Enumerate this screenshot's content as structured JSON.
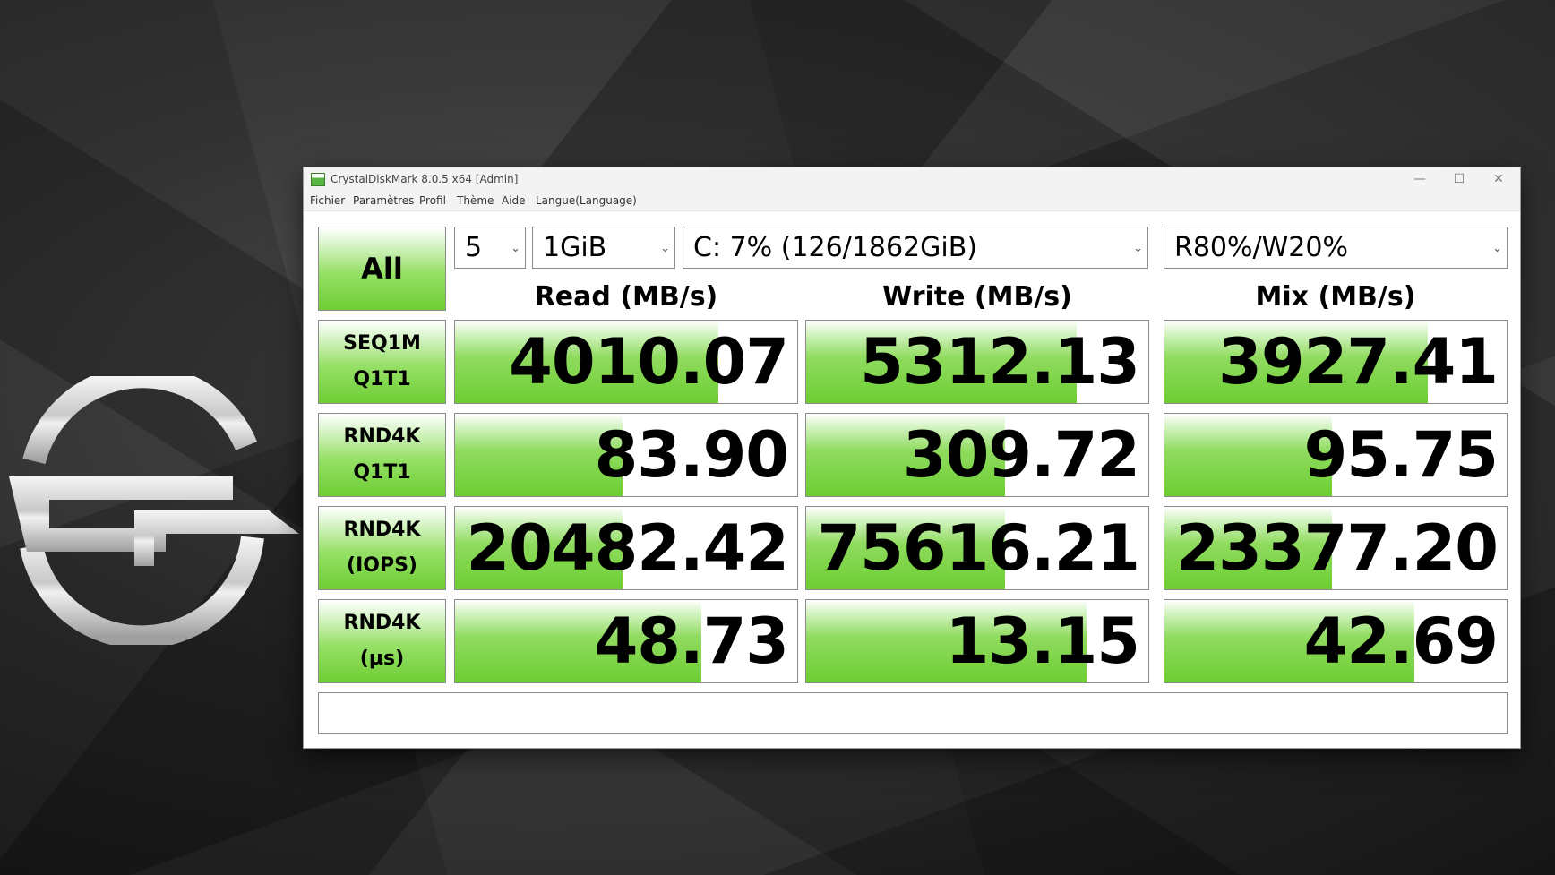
{
  "window": {
    "title": "CrystalDiskMark 8.0.5 x64 [Admin]",
    "controls": {
      "minimize": "—",
      "maximize": "☐",
      "close": "✕"
    }
  },
  "menu": [
    "Fichier",
    "Paramètres",
    "Profil",
    "Thème",
    "Aide",
    "Langue(Language)"
  ],
  "toolbar": {
    "all_label": "All",
    "count": "5",
    "size": "1GiB",
    "drive": "C: 7% (126/1862GiB)",
    "mix": "R80%/W20%"
  },
  "headers": {
    "read": "Read (MB/s)",
    "write": "Write (MB/s)",
    "mix": "Mix (MB/s)"
  },
  "rows": [
    {
      "label1": "SEQ1M",
      "label2": "Q1T1",
      "read": "4010.07",
      "write": "5312.13",
      "mix": "3927.41",
      "read_fill": 0.77,
      "write_fill": 0.79,
      "mix_fill": 0.77
    },
    {
      "label1": "RND4K",
      "label2": "Q1T1",
      "read": "83.90",
      "write": "309.72",
      "mix": "95.75",
      "read_fill": 0.49,
      "write_fill": 0.58,
      "mix_fill": 0.49
    },
    {
      "label1": "RND4K",
      "label2": "(IOPS)",
      "read": "20482.42",
      "write": "75616.21",
      "mix": "23377.20",
      "read_fill": 0.49,
      "write_fill": 0.58,
      "mix_fill": 0.49
    },
    {
      "label1": "RND4K",
      "label2": "(µs)",
      "read": "48.73",
      "write": "13.15",
      "mix": "42.69",
      "read_fill": 0.72,
      "write_fill": 0.82,
      "mix_fill": 0.73
    }
  ],
  "status": "",
  "colors": {
    "bar_green": "#6dce32",
    "border": "#8a8a8a"
  },
  "icons": {
    "app": "crystaldiskmark-icon",
    "logo": "site-logo-icon"
  }
}
